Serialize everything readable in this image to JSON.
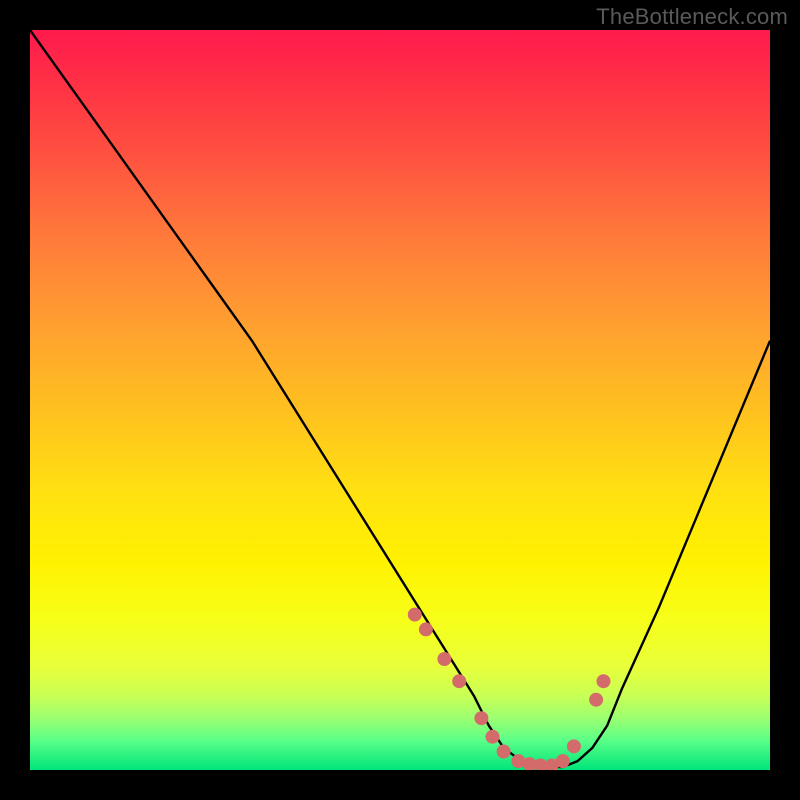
{
  "watermark": "TheBottleneck.com",
  "chart_data": {
    "type": "line",
    "title": "",
    "xlabel": "",
    "ylabel": "",
    "xlim": [
      0,
      100
    ],
    "ylim": [
      0,
      100
    ],
    "x": [
      0,
      5,
      10,
      15,
      20,
      25,
      30,
      35,
      40,
      45,
      50,
      55,
      60,
      62,
      64,
      66,
      68,
      70,
      72,
      74,
      76,
      78,
      80,
      85,
      90,
      95,
      100
    ],
    "values": [
      100,
      93,
      86,
      79,
      72,
      65,
      58,
      50,
      42,
      34,
      26,
      18,
      10,
      6,
      3,
      1.5,
      0.8,
      0.4,
      0.4,
      1.2,
      3,
      6,
      11,
      22,
      34,
      46,
      58
    ],
    "markers": {
      "x": [
        52,
        53.5,
        56,
        58,
        61,
        62.5,
        64,
        66,
        67.5,
        69,
        70.5,
        72,
        73.5,
        76.5,
        77.5
      ],
      "y": [
        21,
        19,
        15,
        12,
        7,
        4.5,
        2.5,
        1.2,
        0.8,
        0.6,
        0.6,
        1.2,
        3.2,
        9.5,
        12
      ],
      "color": "#d36b6b"
    },
    "colors": {
      "curve": "#000000",
      "marker": "#d36b6b",
      "background_top": "#ff1a4d",
      "background_bottom": "#00e57a"
    }
  }
}
